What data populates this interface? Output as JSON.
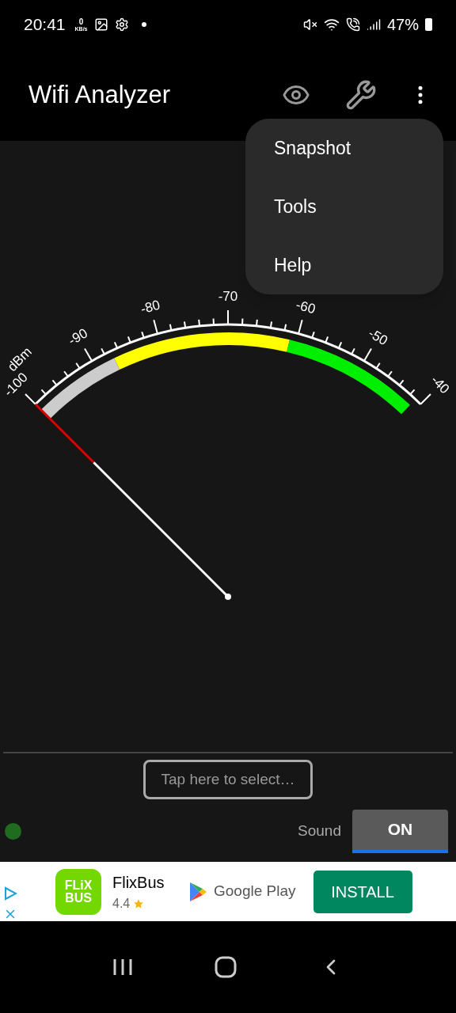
{
  "status_bar": {
    "time": "20:41",
    "speed_value": "0",
    "speed_unit": "KB/s",
    "battery": "47%"
  },
  "app_bar": {
    "title": "Wifi Analyzer"
  },
  "menu": [
    {
      "label": "Snapshot"
    },
    {
      "label": "Tools"
    },
    {
      "label": "Help"
    }
  ],
  "gauge": {
    "unit": "dBm",
    "scale_labels": [
      "-100",
      "-90",
      "-80",
      "-70",
      "-60",
      "-50",
      "-40"
    ]
  },
  "network_field": {
    "placeholder": "Tap here to select…"
  },
  "sound": {
    "label": "Sound",
    "toggle_text": "ON",
    "on": true
  },
  "ad": {
    "logo_top": "FLiX",
    "logo_bottom": "BUS",
    "name": "FlixBus",
    "rating": "4.4",
    "store": "Google Play",
    "button": "INSTALL"
  }
}
